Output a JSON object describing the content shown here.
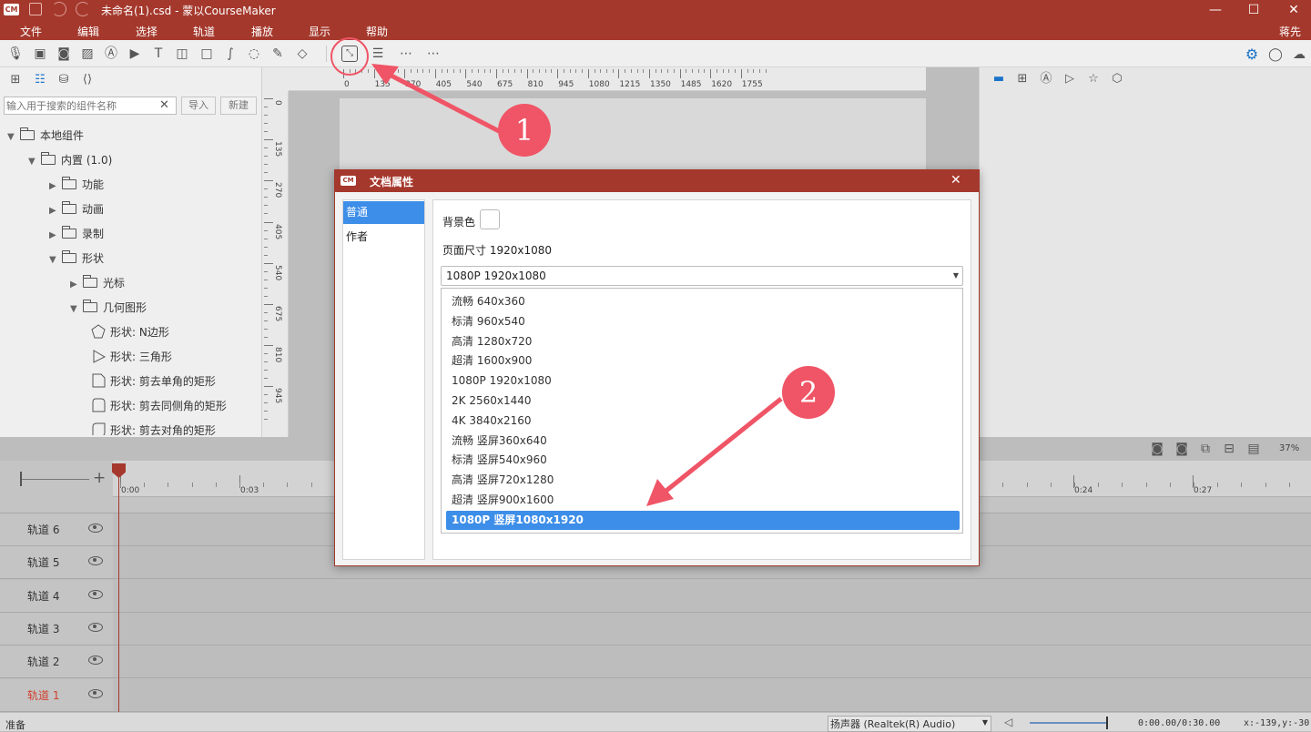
{
  "window": {
    "title": "未命名(1).csd - 蒙以CourseMaker",
    "user": "蒋先生",
    "logo": "CM"
  },
  "menu": [
    "文件",
    "编辑",
    "选择",
    "轨道",
    "播放",
    "显示",
    "帮助"
  ],
  "left_panel": {
    "search_placeholder": "输入用于搜索的组件名称",
    "import_label": "导入",
    "new_label": "新建",
    "tree": [
      {
        "label": "本地组件",
        "depth": 0,
        "state": "open",
        "kind": "folder"
      },
      {
        "label": "内置 (1.0)",
        "depth": 1,
        "state": "open",
        "kind": "folder"
      },
      {
        "label": "功能",
        "depth": 2,
        "state": "closed",
        "kind": "folder"
      },
      {
        "label": "动画",
        "depth": 2,
        "state": "closed",
        "kind": "folder"
      },
      {
        "label": "录制",
        "depth": 2,
        "state": "closed",
        "kind": "folder"
      },
      {
        "label": "形状",
        "depth": 2,
        "state": "open",
        "kind": "folder"
      },
      {
        "label": "光标",
        "depth": 3,
        "state": "closed",
        "kind": "folder"
      },
      {
        "label": "几何图形",
        "depth": 3,
        "state": "open",
        "kind": "folder"
      },
      {
        "label": "形状: N边形",
        "depth": 4,
        "kind": "pentagon"
      },
      {
        "label": "形状: 三角形",
        "depth": 4,
        "kind": "triangle"
      },
      {
        "label": "形状: 剪去单角的矩形",
        "depth": 4,
        "kind": "rect-cut1"
      },
      {
        "label": "形状: 剪去同侧角的矩形",
        "depth": 4,
        "kind": "rect-cut2"
      },
      {
        "label": "形状: 剪去对角的矩形",
        "depth": 4,
        "kind": "rect-cut3"
      }
    ]
  },
  "ruler_h": [
    "0",
    "135",
    "270",
    "405",
    "540",
    "675",
    "810",
    "945",
    "1080",
    "1215",
    "1350",
    "1485",
    "1620",
    "1755"
  ],
  "ruler_v": [
    "0",
    "135",
    "270",
    "405",
    "540",
    "675",
    "810",
    "945"
  ],
  "timeline": {
    "zoom_pct": "37%",
    "ticks": [
      "0:00",
      "0:03",
      "0:24",
      "0:27"
    ],
    "tracks": [
      "轨道 6",
      "轨道 5",
      "轨道 4",
      "轨道 3",
      "轨道 2",
      "轨道 1"
    ],
    "active_track": "轨道 1"
  },
  "status": {
    "text": "准备",
    "audio_device": "扬声器 (Realtek(R) Audio)",
    "time": "0:00.00/0:30.00",
    "coords": "x:-139,y:-30"
  },
  "dialog": {
    "title": "文档属性",
    "tabs": [
      "普通",
      "作者"
    ],
    "active_tab": "普通",
    "bg_color_label": "背景色",
    "page_size_label": "页面尺寸 1920x1080",
    "selected_preset": "1080P 1920x1080",
    "options": [
      "流畅 640x360",
      "标清 960x540",
      "高清 1280x720",
      "超清 1600x900",
      "1080P 1920x1080",
      "2K 2560x1440",
      "4K 3840x2160",
      "流畅 竖屏360x640",
      "标清 竖屏540x960",
      "高清 竖屏720x1280",
      "超清 竖屏900x1600",
      "1080P 竖屏1080x1920"
    ],
    "highlighted_option": "1080P 竖屏1080x1920"
  },
  "annotations": {
    "callout_1": "1",
    "callout_2": "2",
    "accent": "#ef5566"
  },
  "colors": {
    "brand": "#a5382c",
    "selection": "#3d8ee8",
    "gear": "#1a73c8"
  }
}
